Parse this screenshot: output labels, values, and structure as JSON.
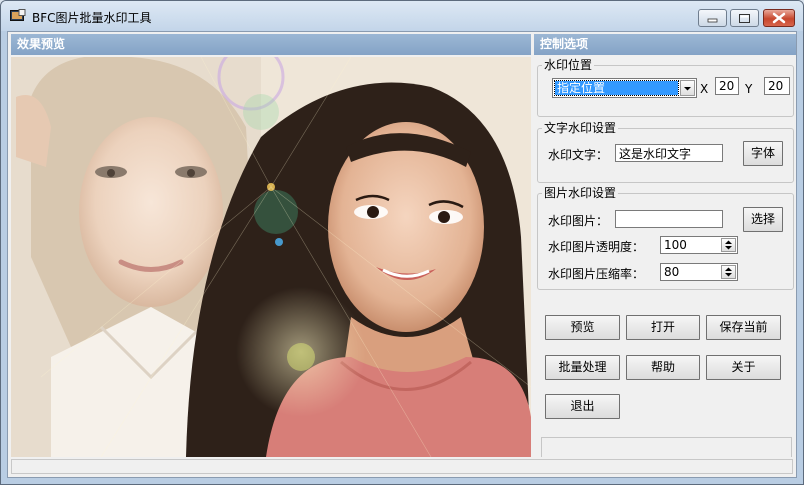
{
  "window": {
    "title": "BFC图片批量水印工具",
    "buttons": [
      "minimize-icon",
      "maximize-icon",
      "close-icon"
    ]
  },
  "preview": {
    "header": "效果预览"
  },
  "options": {
    "header": "控制选项",
    "position": {
      "title": "水印位置",
      "mode": "指定位置",
      "x_label": "X",
      "x_value": "20",
      "y_label": "Y",
      "y_value": "20"
    },
    "text_watermark": {
      "title": "文字水印设置",
      "text_label": "水印文字：",
      "text_value": "这是水印文字",
      "font_button": "字体"
    },
    "image_watermark": {
      "title": "图片水印设置",
      "image_label": "水印图片：",
      "image_value": "",
      "select_button": "选择",
      "opacity_label": "水印图片透明度：",
      "opacity_value": "100",
      "compression_label": "水印图片压缩率：",
      "compression_value": "80"
    },
    "actions": {
      "preview": "预览",
      "open": "打开",
      "save_current": "保存当前",
      "batch": "批量处理",
      "help": "帮助",
      "about": "关于",
      "exit": "退出"
    }
  },
  "colors": {
    "header_blue": "#8aa8ca",
    "selection": "#3399ff",
    "close_red": "#c7472e"
  }
}
